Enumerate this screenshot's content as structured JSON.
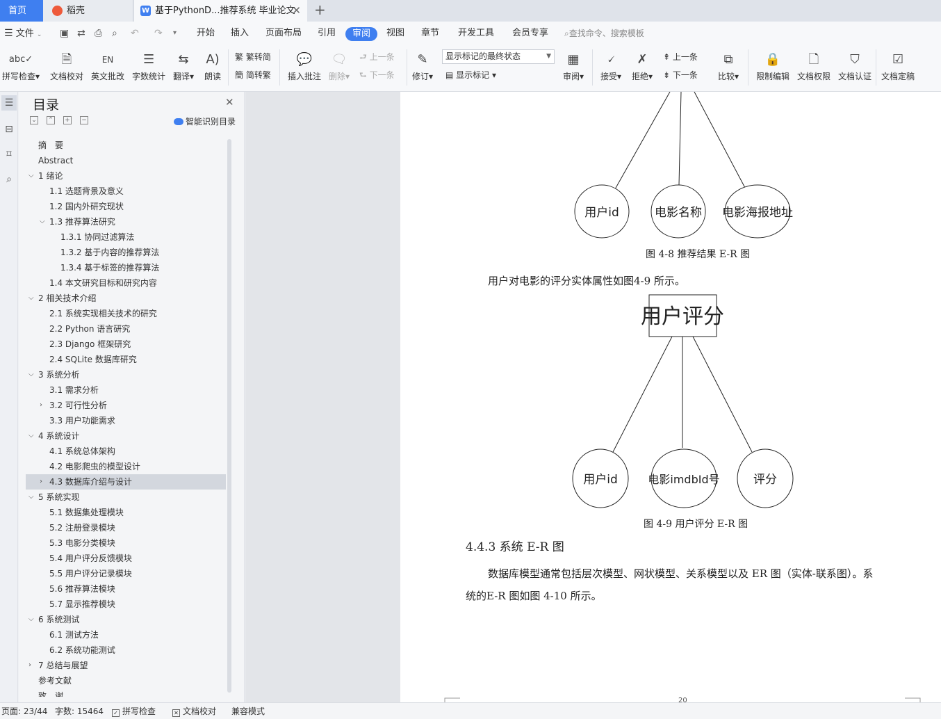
{
  "tabs": {
    "home": "首页",
    "daoke": "稻壳",
    "doc": "基于PythonD...推荐系统 毕业论文"
  },
  "menu": {
    "file": "文件",
    "items": [
      "开始",
      "插入",
      "页面布局",
      "引用",
      "审阅",
      "视图",
      "章节",
      "开发工具",
      "会员专享"
    ],
    "search": "查找命令、搜索模板"
  },
  "ribbon": {
    "spell": "拼写检查",
    "proof": "文档校对",
    "en_review": "英文批改",
    "wordcount": "字数统计",
    "translate": "翻译",
    "read": "朗读",
    "t2s": "繁转简",
    "s2t": "简转繁",
    "insert_comment": "插入批注",
    "delete": "删除",
    "prev_comment": "上一条",
    "next_comment": "下一条",
    "revise": "修订",
    "markup_state": "显示标记的最终状态",
    "show_markup": "显示标记",
    "review_pane": "审阅",
    "accept": "接受",
    "reject": "拒绝",
    "prev_change": "上一条",
    "next_change": "下一条",
    "compare": "比较",
    "restrict": "限制编辑",
    "doc_rights": "文档权限",
    "doc_cert": "文档认证",
    "finalize": "文档定稿"
  },
  "toc": {
    "title": "目录",
    "smart": "智能识别目录",
    "items": [
      "摘　要",
      "Abstract",
      "1 绪论",
      "1.1 选题背景及意义",
      "1.2 国内外研究现状",
      "1.3 推荐算法研究",
      "1.3.1 协同过滤算法",
      "1.3.2 基于内容的推荐算法",
      "1.3.4 基于标签的推荐算法",
      "1.4 本文研究目标和研究内容",
      "2 相关技术介绍",
      "2.1 系统实现相关技术的研究",
      "2.2 Python 语言研究",
      "2.3 Django 框架研究",
      "2.4 SQLite 数据库研究",
      "3 系统分析",
      "3.1 需求分析",
      "3.2 可行性分析",
      "3.3 用户功能需求",
      "4 系统设计",
      "4.1 系统总体架构",
      "4.2 电影爬虫的模型设计",
      "4.3 数据库介绍与设计",
      "5 系统实现",
      "5.1 数据集处理模块",
      "5.2 注册登录模块",
      "5.3 电影分类模块",
      "5.4 用户评分反馈模块",
      "5.5 用户评分记录模块",
      "5.6 推荐算法模块",
      "5.7 显示推荐模块",
      "6 系统测试",
      "6.1 测试方法",
      "6.2 系统功能测试",
      "7 总结与展望",
      "参考文献",
      "致　谢"
    ]
  },
  "doc": {
    "er1_attrs": [
      "用户id",
      "电影名称",
      "电影海报地址"
    ],
    "cap1": "图 4-8 推荐结果 E-R 图",
    "para1": "用户对电影的评分实体属性如图4-9 所示。",
    "er2_entity": "用户评分",
    "er2_attrs": [
      "用户id",
      "电影imdbId号",
      "评分"
    ],
    "cap2": "图 4-9 用户评分  E-R 图",
    "heading": "4.4.3 系统 E-R 图",
    "para2a": "数据库模型通常包括层次模型、网状模型、关系模型以及 ER 图（实体-联系图）。系",
    "para2b": "统的E-R 图如图 4-10 所示。",
    "page_no": "20"
  },
  "status": {
    "page": "页面: 23/44",
    "words": "字数: 15464",
    "spell": "拼写检查",
    "proof": "文档校对",
    "compat": "兼容模式"
  }
}
